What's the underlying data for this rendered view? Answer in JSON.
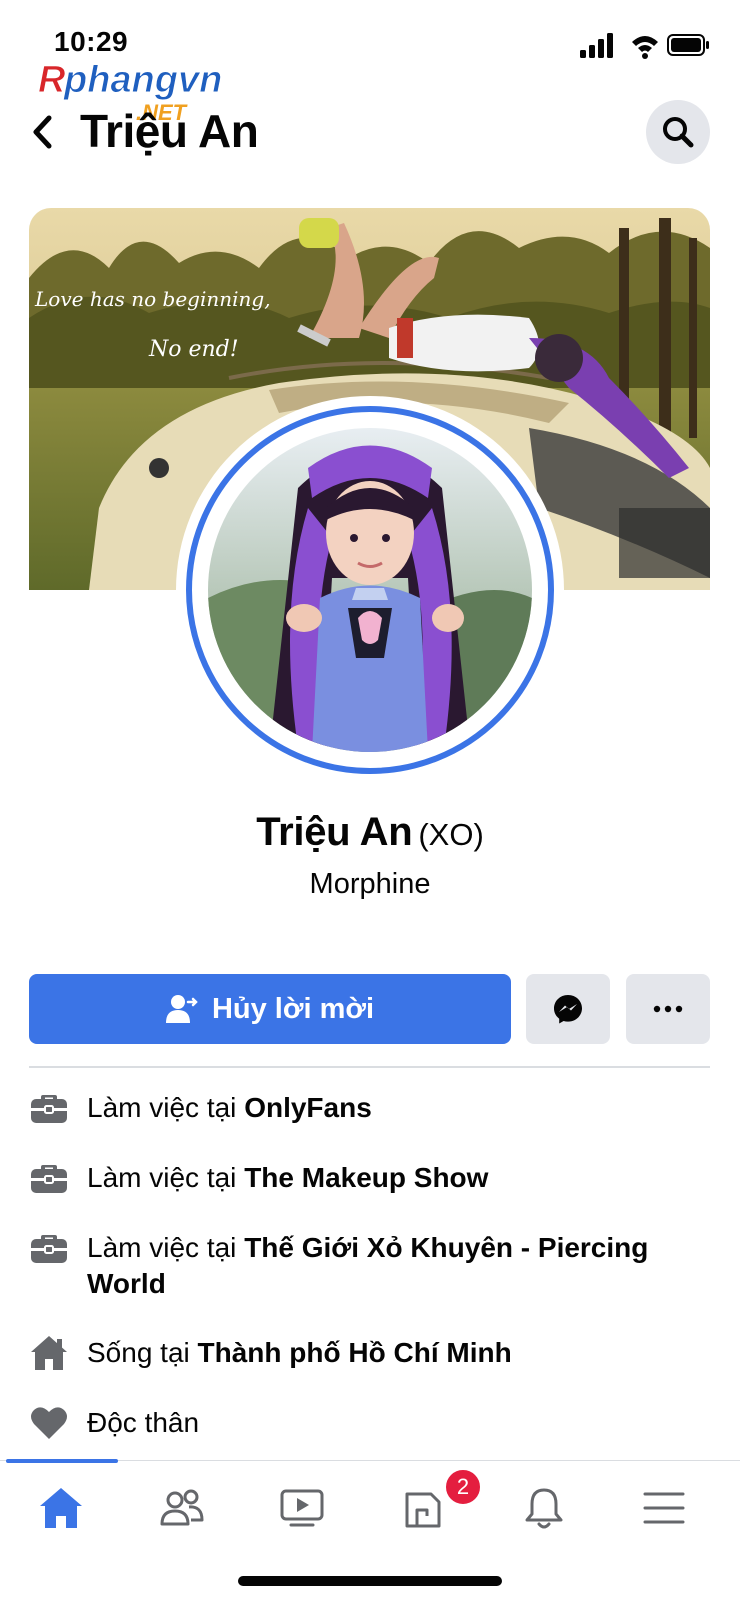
{
  "status_bar": {
    "time": "10:29"
  },
  "watermark": {
    "brand": "Rphangvn",
    "suffix": ".NET"
  },
  "header": {
    "title": "Triệu An"
  },
  "cover": {
    "quote_line1": "Love has no beginning,",
    "quote_line2": "No end!"
  },
  "profile": {
    "name": "Triệu An",
    "alternate_name": "(XO)",
    "subtitle": "Morphine"
  },
  "actions": {
    "primary_label": "Hủy lời mời",
    "primary_icon": "person-cancel-icon",
    "message_icon": "messenger-icon",
    "more_icon": "more-dots-icon"
  },
  "intro": [
    {
      "icon": "briefcase-icon",
      "prefix": "Làm việc tại",
      "value": "OnlyFans"
    },
    {
      "icon": "briefcase-icon",
      "prefix": "Làm việc tại",
      "value": "The Makeup Show"
    },
    {
      "icon": "briefcase-icon",
      "prefix": "Làm việc tại",
      "value": "Thế Giới Xỏ Khuyên - Piercing World"
    },
    {
      "icon": "home-icon",
      "prefix": "Sống tại",
      "value": "Thành phố Hồ Chí Minh"
    },
    {
      "icon": "heart-icon",
      "prefix": "",
      "value": "Độc thân"
    }
  ],
  "bottom_nav": {
    "items": [
      "home",
      "friends",
      "watch",
      "pages",
      "notifications",
      "menu"
    ],
    "active": "home",
    "pages_badge": "2"
  },
  "colors": {
    "accent": "#3b74e6",
    "badge": "#e41e3f",
    "grey_button": "#e4e6eb"
  }
}
